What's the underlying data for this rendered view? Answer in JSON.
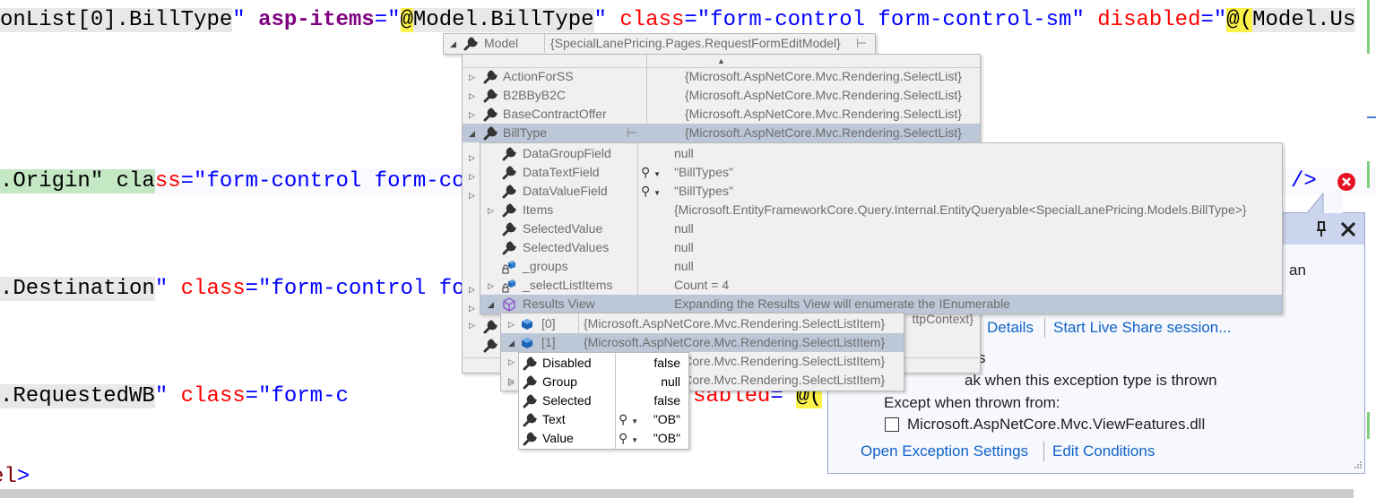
{
  "code": {
    "line1": {
      "a": "onList[0].BillType",
      "b": "\"",
      "c": "asp-items",
      "d": "=\"",
      "e": "@",
      "f": "Model.BillType",
      "g": "\"",
      "h": "class",
      "i": "=\"form-control form-control-sm\"",
      "j": "disabled",
      "k": "=\"",
      "l": "@(",
      "m": "Model.Us"
    },
    "line2": {
      "a": ".Origin\" cla",
      "b": "ss",
      "c": "=\"form-control form-co",
      "end": "/>"
    },
    "line3": {
      "a": ".Destination",
      "b": "\"",
      "c": "class",
      "d": "=\"form-control fo"
    },
    "line4": {
      "a": ".RequestedWB",
      "b": "\"",
      "c": "class",
      "d": "=\"form-c",
      "e": "sabled",
      "f": "=",
      "g": "@("
    },
    "line5": {
      "a": "el",
      "b": ">"
    }
  },
  "datatip_root": {
    "name": "Model",
    "value": "{SpecialLanePricing.Pages.RequestFormEditModel}"
  },
  "model_members": [
    {
      "name": "ActionForSS",
      "value": "{Microsoft.AspNetCore.Mvc.Rendering.SelectList}",
      "expander": "collapsed",
      "icon": "wrench"
    },
    {
      "name": "B2BByB2C",
      "value": "{Microsoft.AspNetCore.Mvc.Rendering.SelectList}",
      "expander": "collapsed",
      "icon": "wrench"
    },
    {
      "name": "BaseContractOffer",
      "value": "{Microsoft.AspNetCore.Mvc.Rendering.SelectList}",
      "expander": "collapsed",
      "icon": "wrench"
    },
    {
      "name": "BillType",
      "value": "{Microsoft.AspNetCore.Mvc.Rendering.SelectList}",
      "expander": "expanded",
      "icon": "wrench",
      "selected": true,
      "pin": true
    }
  ],
  "model_hidden_value_fragment": "ttpContext}",
  "billtype_members": [
    {
      "name": "DataGroupField",
      "value": "null",
      "expander": "",
      "icon": "wrench"
    },
    {
      "name": "DataTextField",
      "value": "\"BillTypes\"",
      "expander": "",
      "icon": "wrench",
      "magnifier": true
    },
    {
      "name": "DataValueField",
      "value": "\"BillTypes\"",
      "expander": "",
      "icon": "wrench",
      "magnifier": true
    },
    {
      "name": "Items",
      "value": "{Microsoft.EntityFrameworkCore.Query.Internal.EntityQueryable<SpecialLanePricing.Models.BillType>}",
      "expander": "collapsed",
      "icon": "wrench"
    },
    {
      "name": "SelectedValue",
      "value": "null",
      "expander": "",
      "icon": "wrench"
    },
    {
      "name": "SelectedValues",
      "value": "null",
      "expander": "",
      "icon": "wrench"
    },
    {
      "name": "_groups",
      "value": "null",
      "expander": "",
      "icon": "field"
    },
    {
      "name": "_selectListItems",
      "value": "Count = 4",
      "expander": "collapsed",
      "icon": "field"
    },
    {
      "name": "Results View",
      "value": "Expanding the Results View will enumerate the IEnumerable",
      "expander": "expanded",
      "icon": "results",
      "selected": true
    }
  ],
  "results_items": [
    {
      "name": "[0]",
      "value": "{Microsoft.AspNetCore.Mvc.Rendering.SelectListItem}",
      "expander": "collapsed",
      "icon": "element"
    },
    {
      "name": "[1]",
      "value": "{Microsoft.AspNetCore.Mvc.Rendering.SelectListItem}",
      "expander": "expanded",
      "icon": "element",
      "selected": true
    },
    {
      "name": "",
      "value": "{Microsoft.AspNetCore.Mvc.Rendering.SelectListItem}",
      "expander": "collapsed",
      "icon": ""
    },
    {
      "name": "",
      "value": "{Microsoft.AspNetCore.Mvc.Rendering.SelectListItem}",
      "expander": "collapsed",
      "icon": ""
    }
  ],
  "item1_members": [
    {
      "name": "Disabled",
      "value": "false",
      "icon": "wrench"
    },
    {
      "name": "Group",
      "value": "null",
      "icon": "wrench",
      "expander": "collapsed"
    },
    {
      "name": "Selected",
      "value": "false",
      "icon": "wrench"
    },
    {
      "name": "Text",
      "value": "\"OB\"",
      "icon": "wrench",
      "magnifier": true
    },
    {
      "name": "Value",
      "value": "\"OB\"",
      "icon": "wrench",
      "magnifier": true
    }
  ],
  "exception": {
    "frag_an": "an",
    "view_details": "Details",
    "live_share": "Start Live Share session...",
    "frag_s": "s",
    "break_text": "ak when this exception type is thrown",
    "except_label": "Except when thrown from:",
    "module": "Microsoft.AspNetCore.Mvc.ViewFeatures.dll",
    "module_checked": false,
    "open_settings": "Open Exception Settings",
    "edit_conditions": "Edit Conditions"
  },
  "colors": {
    "selected_row": "#bcc7d8",
    "popup_bg": "#f0f0f0",
    "link": "#0e63c6",
    "error": "#e81123"
  }
}
